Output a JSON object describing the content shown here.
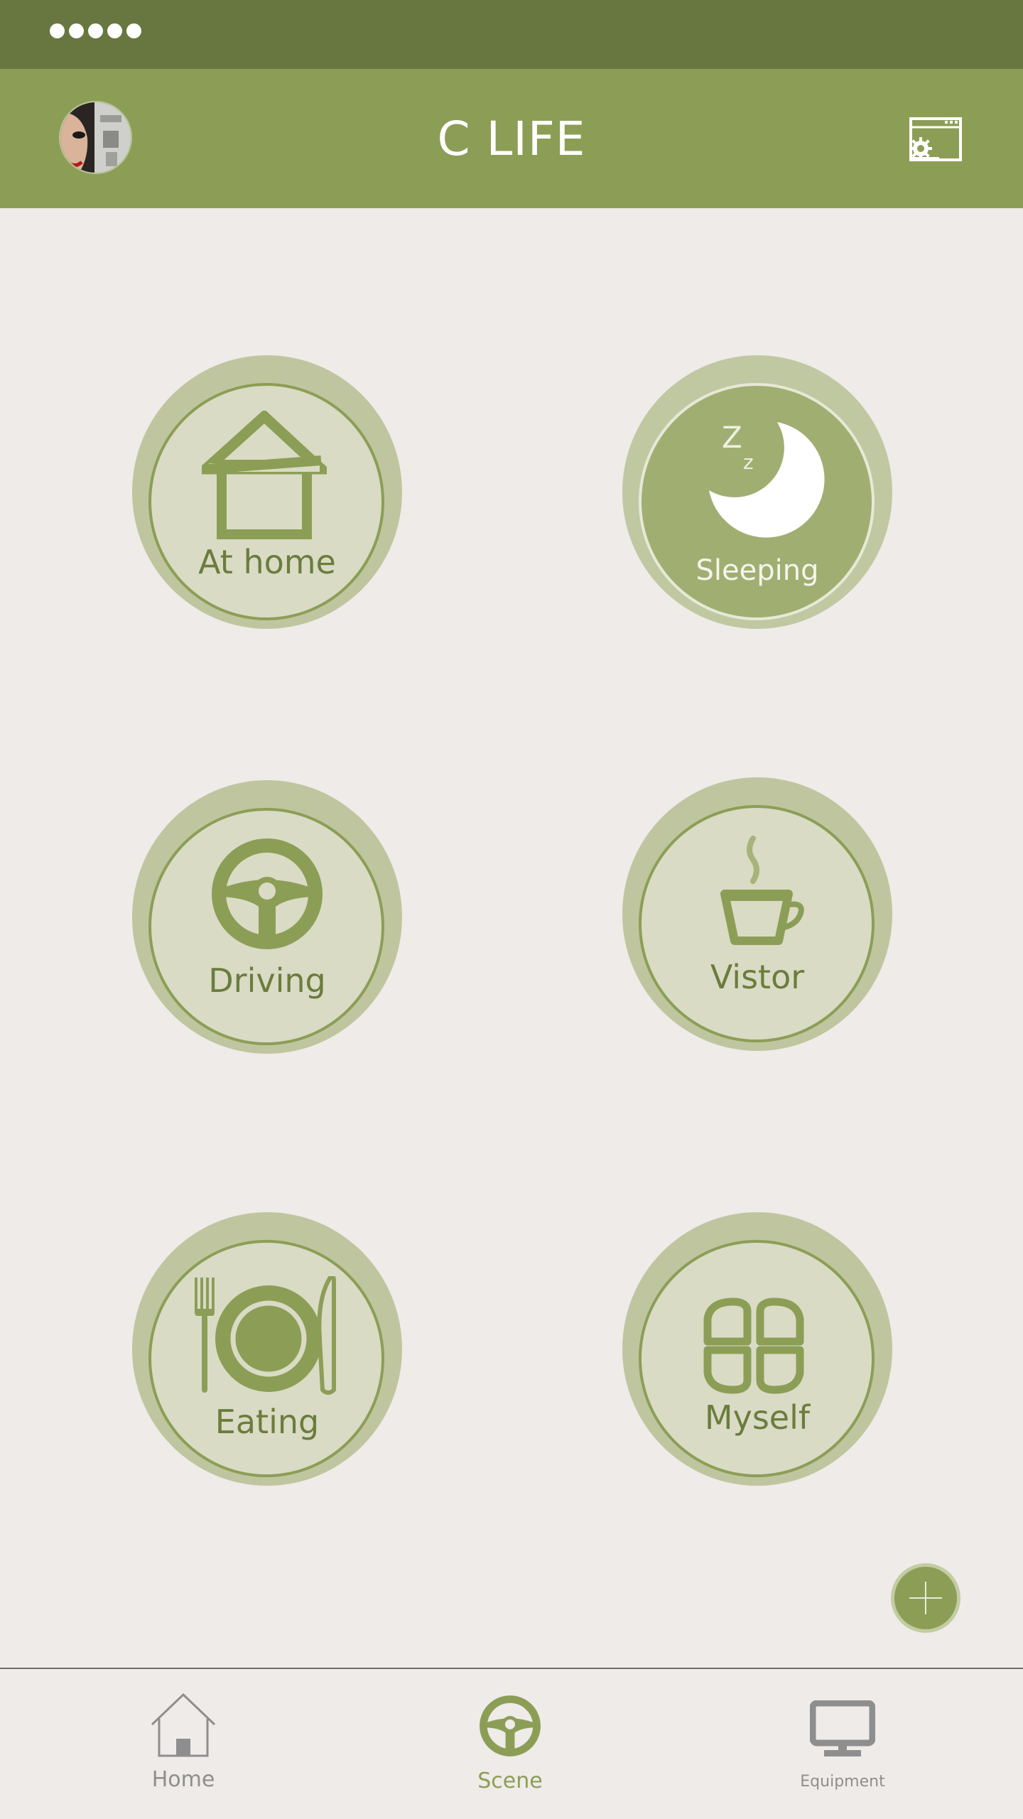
{
  "status_bar": {
    "signal_dots": 5
  },
  "header": {
    "title": "C LIFE",
    "avatar_icon": "user-avatar",
    "settings_icon": "window-settings-icon"
  },
  "scenes": [
    {
      "label": "At home",
      "icon": "house-icon",
      "active": false
    },
    {
      "label": "Sleeping",
      "icon": "moon-sleep-icon",
      "active": true
    },
    {
      "label": "Driving",
      "icon": "steering-wheel-icon",
      "active": false
    },
    {
      "label": "Vistor",
      "icon": "coffee-cup-icon",
      "active": false
    },
    {
      "label": "Eating",
      "icon": "plate-cutlery-icon",
      "active": false
    },
    {
      "label": "Myself",
      "icon": "four-leaf-icon",
      "active": false
    }
  ],
  "add_button": {
    "icon": "plus-icon"
  },
  "tabs": [
    {
      "label": "Home",
      "icon": "home-icon",
      "active": false
    },
    {
      "label": "Scene",
      "icon": "steering-wheel-icon",
      "active": true
    },
    {
      "label": "Equipment",
      "icon": "monitor-icon",
      "active": false
    }
  ],
  "colors": {
    "status_bar": "#67773f",
    "header": "#8c9e56",
    "background": "#efebe8",
    "accent": "#8c9e56",
    "label_text": "#6b7c3c",
    "tab_inactive": "#8e8e8e"
  }
}
